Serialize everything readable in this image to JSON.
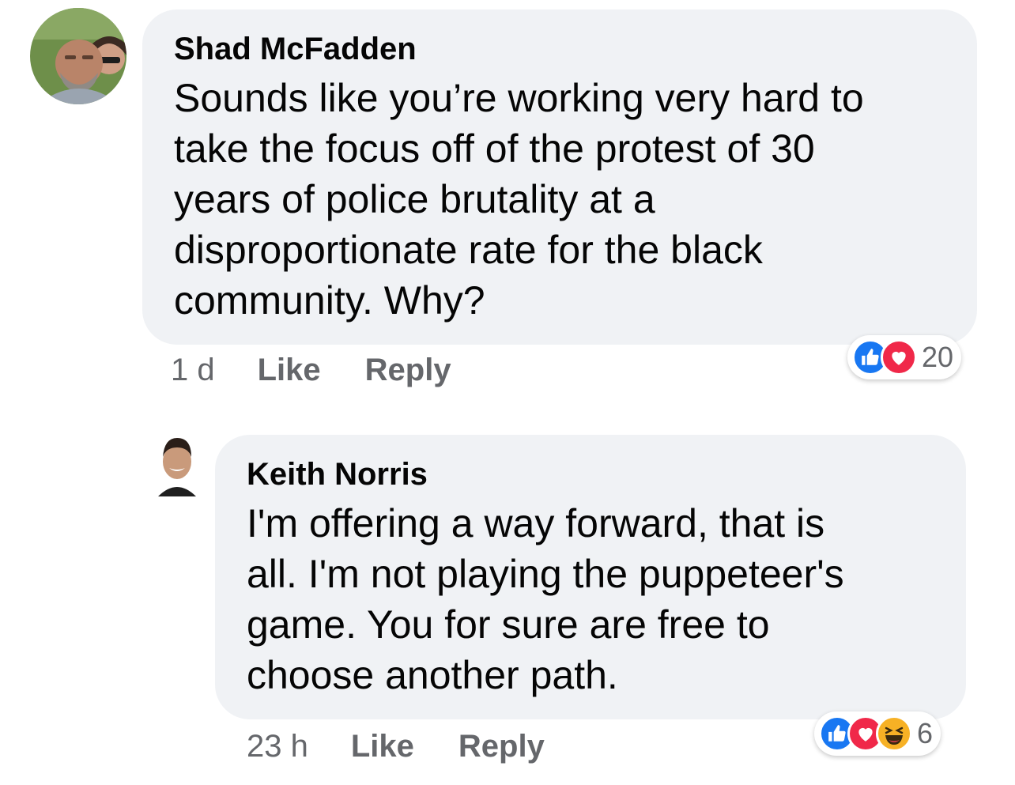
{
  "colors": {
    "bubble": "#f0f2f5",
    "meta_text": "#65676b",
    "like_blue": "#1877f2",
    "love_red": "#f02849",
    "haha_yellow": "#f7b125"
  },
  "comments": [
    {
      "author": "Shad McFadden",
      "lines": [
        "Sounds like you’re working very hard to",
        "take the focus off of the protest of 30",
        "years of police brutality at a",
        "disproportionate rate for the black",
        "community.  Why?"
      ],
      "time": "1 d",
      "like_label": "Like",
      "reply_label": "Reply",
      "reactions": [
        "like-icon",
        "love-icon"
      ],
      "reaction_count": "20"
    },
    {
      "author": "Keith Norris",
      "lines": [
        "I'm offering a way forward, that is",
        "all.  I'm not playing the puppeteer's",
        "game.  You for sure are free to",
        "choose another path."
      ],
      "time": "23 h",
      "like_label": "Like",
      "reply_label": "Reply",
      "reactions": [
        "like-icon",
        "love-icon",
        "haha-icon"
      ],
      "reaction_count": "6"
    }
  ]
}
